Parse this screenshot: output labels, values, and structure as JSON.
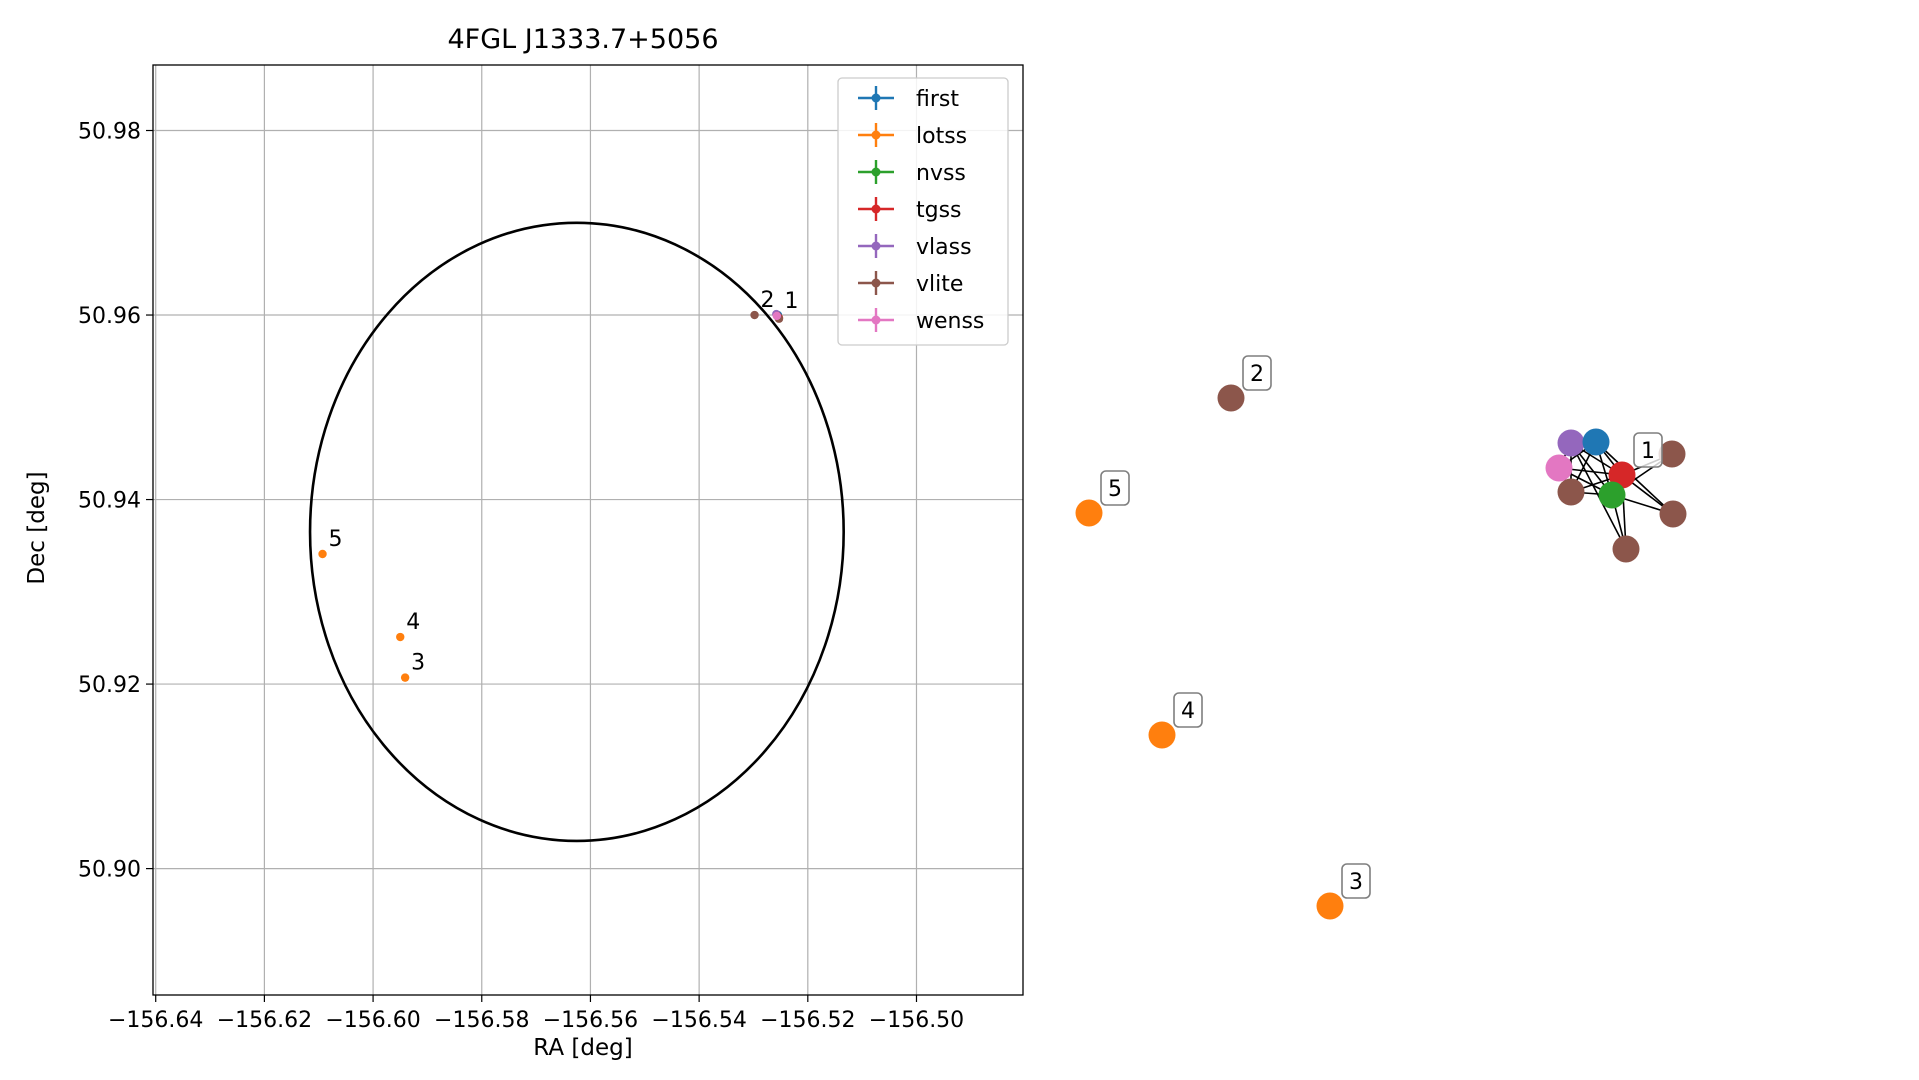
{
  "chart_data": [
    {
      "type": "scatter",
      "title": "4FGL J1333.7+5056",
      "xlabel": "RA [deg]",
      "ylabel": "Dec [deg]",
      "xlim": [
        -156.6405,
        -156.4804
      ],
      "ylim": [
        50.8863,
        50.9871
      ],
      "x_ticks": [
        -156.64,
        -156.62,
        -156.6,
        -156.58,
        -156.56,
        -156.54,
        -156.52,
        -156.5
      ],
      "x_tick_labels": [
        "−156.64",
        "−156.62",
        "−156.60",
        "−156.58",
        "−156.56",
        "−156.54",
        "−156.52",
        "−156.50"
      ],
      "y_ticks": [
        50.9,
        50.92,
        50.94,
        50.96,
        50.98
      ],
      "y_tick_labels": [
        "50.90",
        "50.92",
        "50.94",
        "50.96",
        "50.98"
      ],
      "grid": true,
      "legend_position": "top-right",
      "ellipse": {
        "center_ra": -156.5625,
        "center_dec": 50.9365,
        "semi_ra": 0.0491,
        "semi_dec": 0.0335
      },
      "series": [
        {
          "name": "first",
          "color": "#1f77b4",
          "points": [
            [
              -156.5255,
              50.96
            ]
          ]
        },
        {
          "name": "lotss",
          "color": "#ff7f0e",
          "points": [
            [
              -156.6093,
              50.9341
            ],
            [
              -156.595,
              50.9251
            ],
            [
              -156.5941,
              50.9207
            ]
          ]
        },
        {
          "name": "nvss",
          "color": "#2ca02c",
          "points": [
            [
              -156.5255,
              50.9598
            ]
          ]
        },
        {
          "name": "tgss",
          "color": "#d62728",
          "points": [
            [
              -156.5253,
              50.9597
            ]
          ]
        },
        {
          "name": "vlass",
          "color": "#9467bd",
          "points": [
            [
              -156.5258,
              50.9601
            ]
          ]
        },
        {
          "name": "vlite",
          "color": "#8c564b",
          "points": [
            [
              -156.5298,
              50.96
            ],
            [
              -156.5253,
              50.9596
            ],
            [
              -156.5256,
              50.9599
            ]
          ]
        },
        {
          "name": "wenss",
          "color": "#e377c2",
          "points": [
            [
              -156.5257,
              50.9599
            ]
          ]
        }
      ],
      "point_labels": [
        {
          "text": "1",
          "ra": -156.5254,
          "dec": 50.9599
        },
        {
          "text": "2",
          "ra": -156.5298,
          "dec": 50.96
        },
        {
          "text": "3",
          "ra": -156.5941,
          "dec": 50.9207
        },
        {
          "text": "4",
          "ra": -156.595,
          "dec": 50.9251
        },
        {
          "text": "5",
          "ra": -156.6093,
          "dec": 50.9341
        }
      ]
    },
    {
      "type": "network",
      "nodes": [
        {
          "id": "n-first",
          "color": "#1f77b4"
        },
        {
          "id": "n-vlass",
          "color": "#9467bd"
        },
        {
          "id": "n-wenss",
          "color": "#e377c2"
        },
        {
          "id": "n-tgss",
          "color": "#d62728"
        },
        {
          "id": "n-nvss",
          "color": "#2ca02c"
        },
        {
          "id": "n-vlite-a",
          "color": "#8c564b"
        },
        {
          "id": "n-vlite-b",
          "color": "#8c564b"
        },
        {
          "id": "n-vlite-c",
          "color": "#8c564b"
        },
        {
          "id": "n-vlite-d",
          "color": "#8c564b"
        },
        {
          "id": "n-vlite-2",
          "color": "#8c564b"
        },
        {
          "id": "n-lotss-5",
          "color": "#ff7f0e"
        },
        {
          "id": "n-lotss-4",
          "color": "#ff7f0e"
        },
        {
          "id": "n-lotss-3",
          "color": "#ff7f0e"
        }
      ],
      "edges": [
        [
          "n-first",
          "n-vlass"
        ],
        [
          "n-first",
          "n-wenss"
        ],
        [
          "n-first",
          "n-tgss"
        ],
        [
          "n-first",
          "n-nvss"
        ],
        [
          "n-first",
          "n-vlite-a"
        ],
        [
          "n-vlass",
          "n-wenss"
        ],
        [
          "n-vlass",
          "n-tgss"
        ],
        [
          "n-vlass",
          "n-nvss"
        ],
        [
          "n-vlass",
          "n-vlite-a"
        ],
        [
          "n-wenss",
          "n-tgss"
        ],
        [
          "n-wenss",
          "n-nvss"
        ],
        [
          "n-wenss",
          "n-vlite-a"
        ],
        [
          "n-tgss",
          "n-nvss"
        ],
        [
          "n-tgss",
          "n-vlite-a"
        ],
        [
          "n-tgss",
          "n-vlite-b"
        ],
        [
          "n-tgss",
          "n-vlite-c"
        ],
        [
          "n-tgss",
          "n-vlite-d"
        ],
        [
          "n-nvss",
          "n-vlite-a"
        ],
        [
          "n-nvss",
          "n-vlite-b"
        ],
        [
          "n-nvss",
          "n-vlite-c"
        ],
        [
          "n-nvss",
          "n-vlite-d"
        ],
        [
          "n-first",
          "n-vlite-c"
        ],
        [
          "n-vlass",
          "n-vlite-d"
        ]
      ],
      "labels": [
        {
          "text": "1",
          "node": "n-tgss"
        },
        {
          "text": "2",
          "node": "n-vlite-2"
        },
        {
          "text": "5",
          "node": "n-lotss-5"
        },
        {
          "text": "4",
          "node": "n-lotss-4"
        },
        {
          "text": "3",
          "node": "n-lotss-3"
        }
      ]
    }
  ]
}
